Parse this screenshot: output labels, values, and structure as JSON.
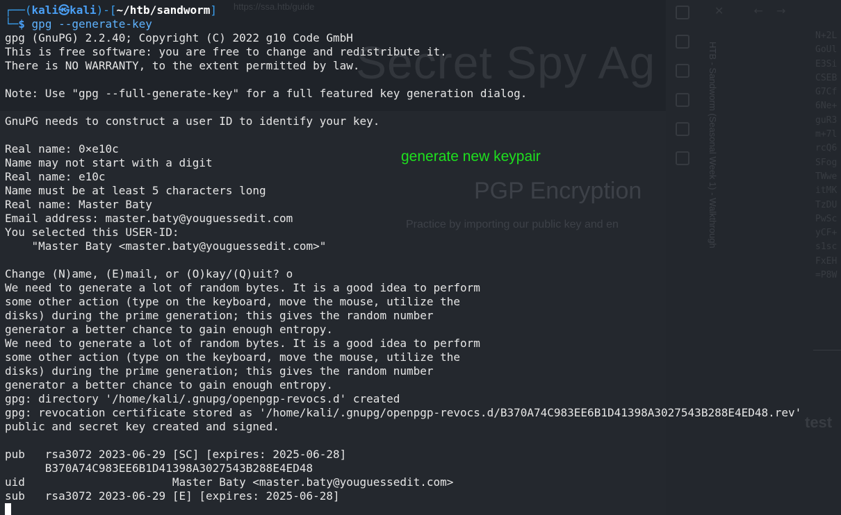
{
  "background_page": {
    "url": "https://ssa.htb/guide",
    "heading": "Secret Spy Ag",
    "subheading": "PGP Encryption",
    "description": "Practice by importing our public key and en",
    "tab_title": "HTB - Sandworm (Seasonal Week 1) - Walkthrough",
    "cipher_fragments": [
      "N+2L",
      "GoUl",
      "E3Si",
      "CSEB",
      "G7Cf",
      "6Ne+",
      "guR3",
      "m+7l",
      "rcQ6",
      "SFog",
      "TWwe",
      "itMK",
      "TzDU",
      "PwSc",
      "yCF+",
      "s1sc",
      "FxEH",
      "=P8W"
    ],
    "test_label": "test"
  },
  "prompt": {
    "frame_left": "┌──(",
    "user": "kali",
    "at": "㉿",
    "host": "kali",
    "mid": ")-[",
    "path": "~/htb/sandworm",
    "close": "]",
    "frame_bottom": "└─",
    "dollar": "$",
    "command": "gpg --generate-key"
  },
  "output_lines": [
    "gpg (GnuPG) 2.2.40; Copyright (C) 2022 g10 Code GmbH",
    "This is free software: you are free to change and redistribute it.",
    "There is NO WARRANTY, to the extent permitted by law.",
    "",
    "Note: Use \"gpg --full-generate-key\" for a full featured key generation dialog.",
    "",
    "GnuPG needs to construct a user ID to identify your key.",
    "",
    "Real name: 0×e10c",
    "Name may not start with a digit",
    "Real name: e10c",
    "Name must be at least 5 characters long",
    "Real name: Master Baty",
    "Email address: master.baty@youguessedit.com",
    "You selected this USER-ID:",
    "    \"Master Baty <master.baty@youguessedit.com>\"",
    "",
    "Change (N)ame, (E)mail, or (O)kay/(Q)uit? o",
    "We need to generate a lot of random bytes. It is a good idea to perform",
    "some other action (type on the keyboard, move the mouse, utilize the",
    "disks) during the prime generation; this gives the random number",
    "generator a better chance to gain enough entropy.",
    "We need to generate a lot of random bytes. It is a good idea to perform",
    "some other action (type on the keyboard, move the mouse, utilize the",
    "disks) during the prime generation; this gives the random number",
    "generator a better chance to gain enough entropy.",
    "gpg: directory '/home/kali/.gnupg/openpgp-revocs.d' created",
    "gpg: revocation certificate stored as '/home/kali/.gnupg/openpgp-revocs.d/B370A74C983EE6B1D41398A3027543B288E4ED48.rev'",
    "public and secret key created and signed.",
    "",
    "pub   rsa3072 2023-06-29 [SC] [expires: 2025-06-28]",
    "      B370A74C983EE6B1D41398A3027543B288E4ED48",
    "uid                      Master Baty <master.baty@youguessedit.com>",
    "sub   rsa3072 2023-06-29 [E] [expires: 2025-06-28]"
  ],
  "annotation": "generate new keypair",
  "colors": {
    "annotation": "#1ee01e",
    "prompt_frame": "#3aa0f0",
    "command": "#5fb3ff",
    "text": "#e6e6e6"
  }
}
